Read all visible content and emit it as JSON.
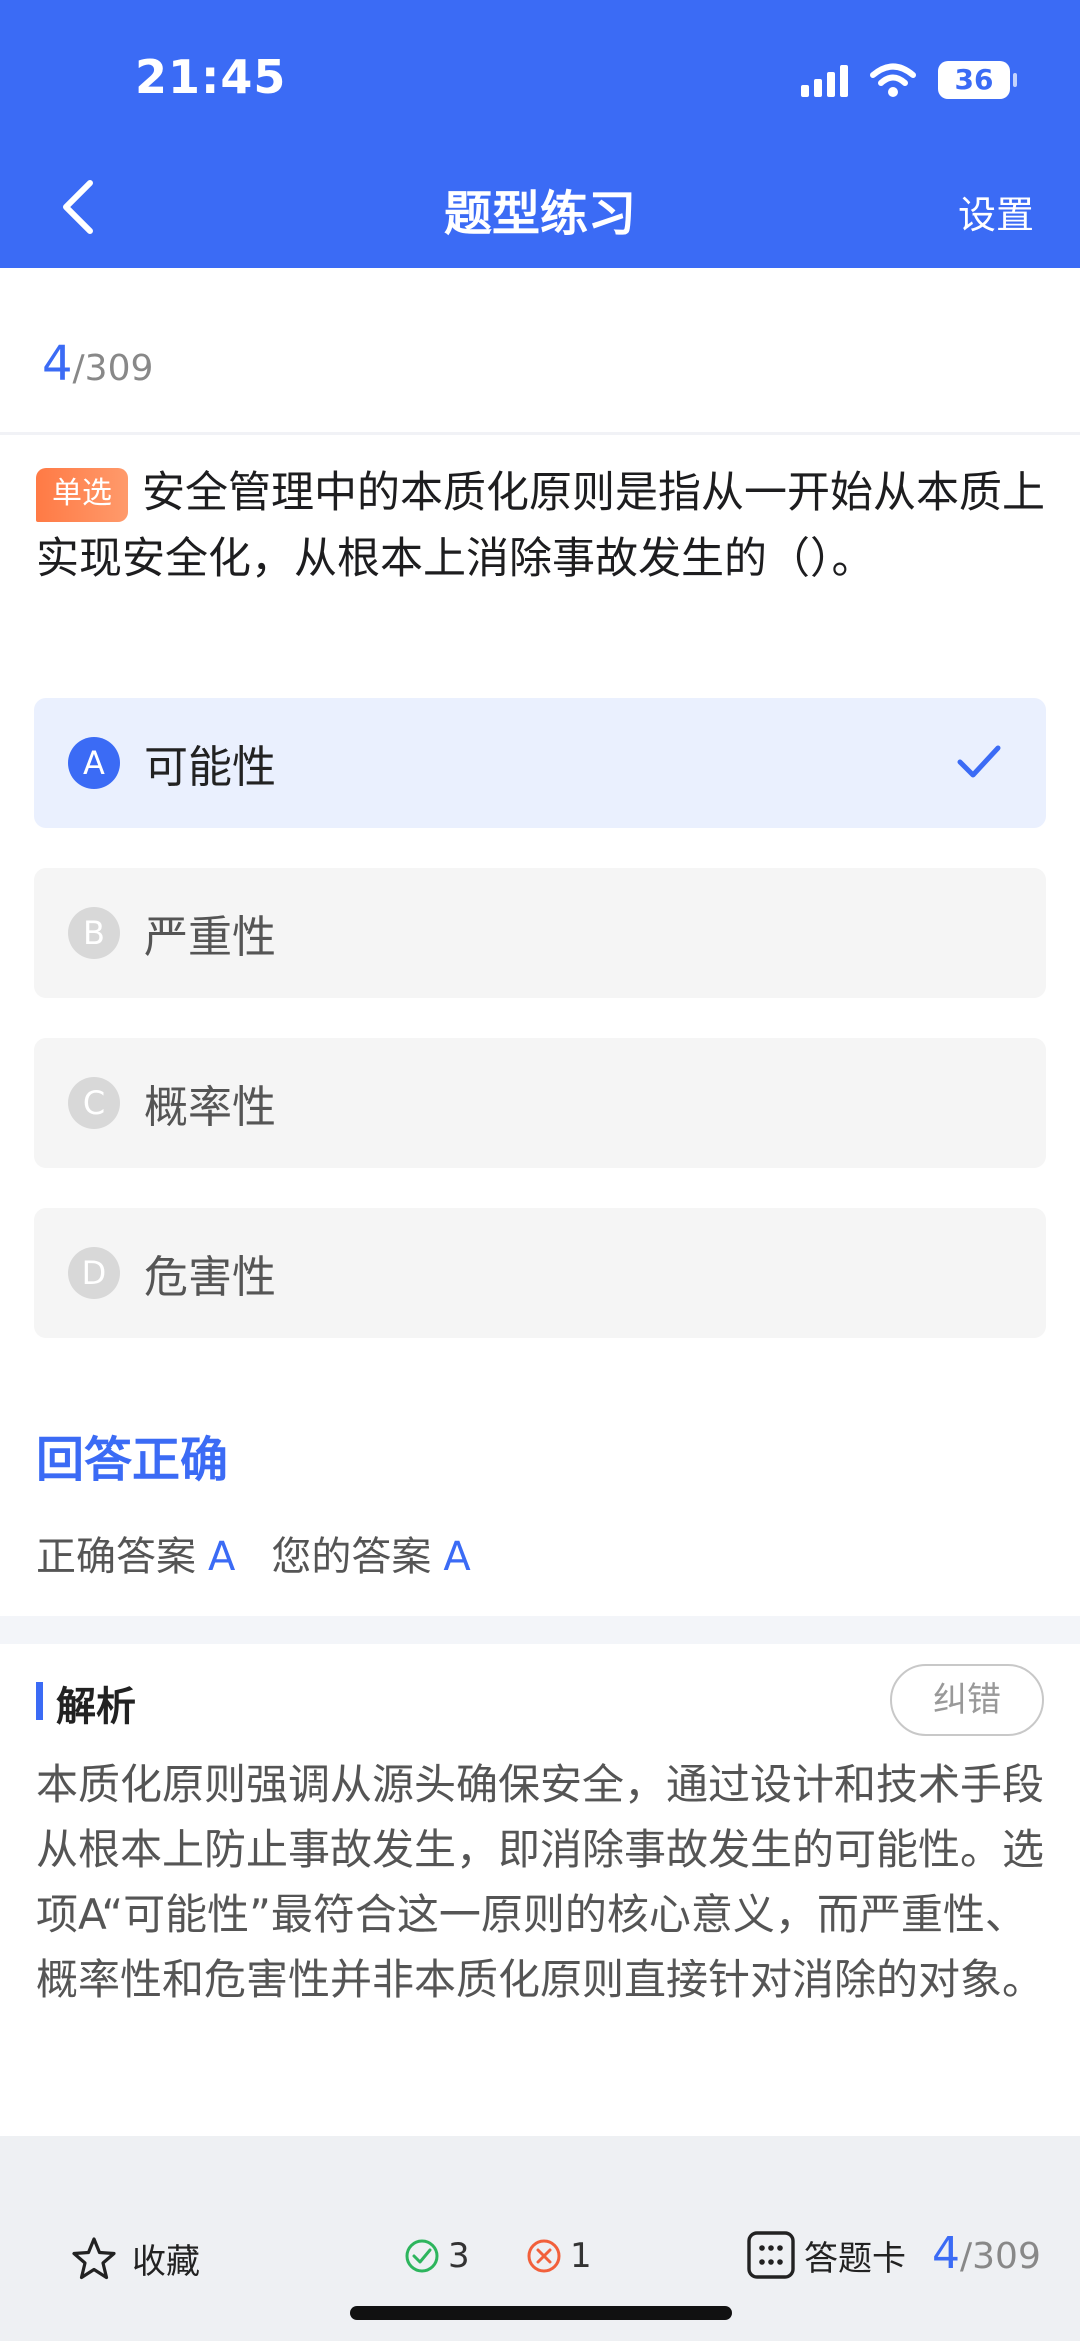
{
  "status_bar": {
    "time": "21:45",
    "battery": "36"
  },
  "nav": {
    "title": "题型练习",
    "settings": "设置"
  },
  "progress": {
    "current": "4",
    "total": "/309"
  },
  "question": {
    "tag": "单选",
    "text": "安全管理中的本质化原则是指从一开始从本质上实现安全化，从根本上消除事故发生的（）。"
  },
  "options": [
    {
      "letter": "A",
      "text": "可能性",
      "selected": true
    },
    {
      "letter": "B",
      "text": "严重性",
      "selected": false
    },
    {
      "letter": "C",
      "text": "概率性",
      "selected": false
    },
    {
      "letter": "D",
      "text": "危害性",
      "selected": false
    }
  ],
  "result": {
    "title": "回答正确",
    "correct_label": "正确答案",
    "correct_value": "A",
    "your_label": "您的答案",
    "your_value": "A"
  },
  "analysis": {
    "title": "解析",
    "report_button": "纠错",
    "text": "本质化原则强调从源头确保安全，通过设计和技术手段从根本上防止事故发生，即消除事故发生的可能性。选项A“可能性”最符合这一原则的核心意义，而严重性、概率性和危害性并非本质化原则直接针对消除的对象。"
  },
  "bottom_bar": {
    "favorite_label": "收藏",
    "right_count": "3",
    "wrong_count": "1",
    "answer_card_label": "答题卡",
    "progress_current": "4",
    "progress_total": "/309"
  },
  "colors": {
    "primary": "#3B6BF5",
    "tag": "#FF7A45",
    "right": "#2DB55D",
    "wrong": "#F2603B"
  },
  "icons": [
    "back-arrow-icon",
    "signal-icon",
    "wifi-icon",
    "battery-icon",
    "check-icon",
    "star-icon",
    "check-circle-icon",
    "x-circle-icon",
    "grid-icon"
  ]
}
